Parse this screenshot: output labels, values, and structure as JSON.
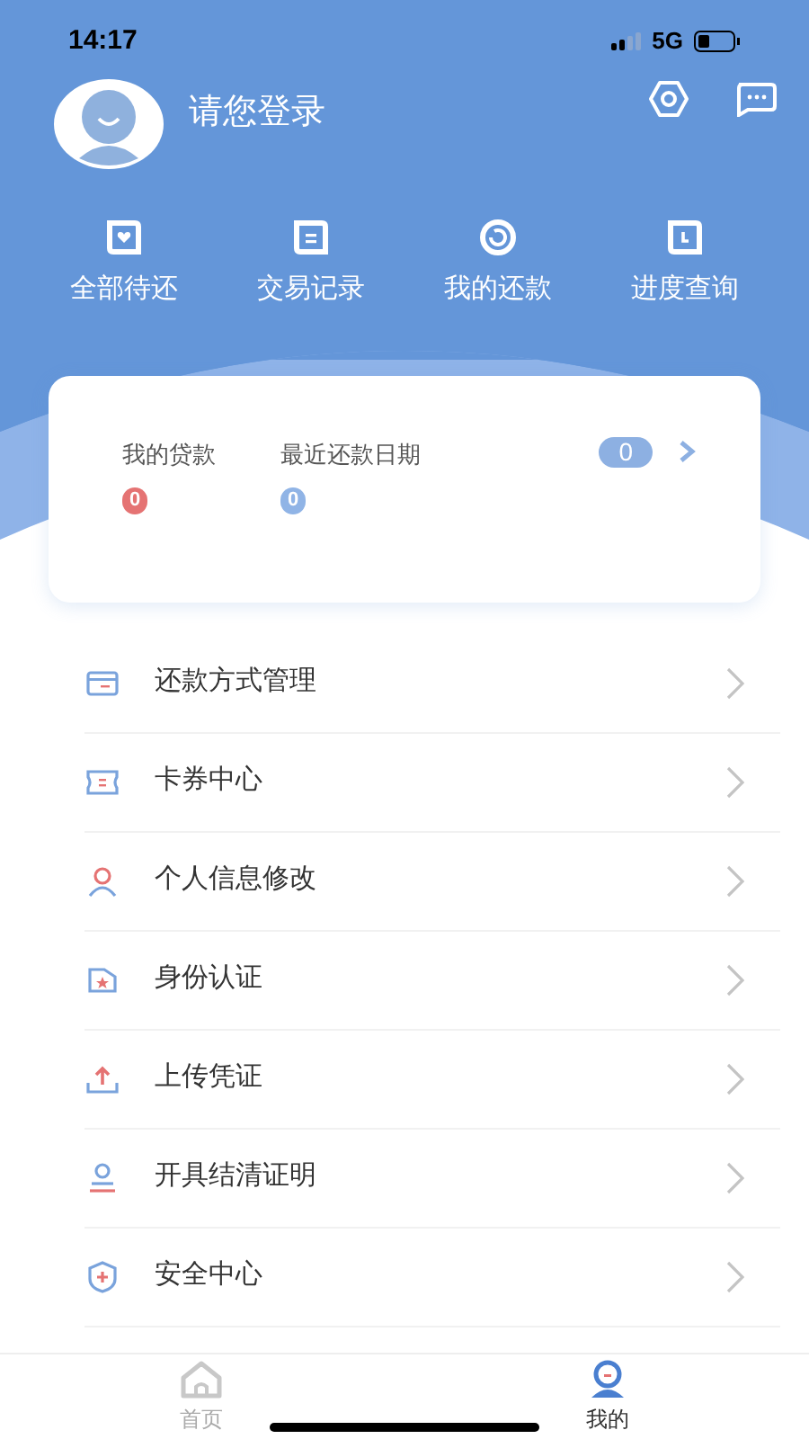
{
  "status_bar": {
    "time": "14:17",
    "network": "5G"
  },
  "profile": {
    "name": "请您登录"
  },
  "shortcuts": [
    {
      "label": "全部待还"
    },
    {
      "label": "交易记录"
    },
    {
      "label": "我的还款"
    },
    {
      "label": "进度查询"
    }
  ],
  "loan_card": {
    "stats": [
      {
        "label": "我的贷款",
        "value": "0",
        "color": "#e57373"
      },
      {
        "label": "最近还款日期",
        "value": "0",
        "color": "#90b4e6"
      }
    ],
    "count": "0"
  },
  "menu": [
    {
      "label": "还款方式管理"
    },
    {
      "label": "卡券中心"
    },
    {
      "label": "个人信息修改"
    },
    {
      "label": "身份认证"
    },
    {
      "label": "上传凭证"
    },
    {
      "label": "开具结清证明"
    },
    {
      "label": "安全中心"
    }
  ],
  "tab_bar": [
    {
      "label": "首页",
      "selected": false
    },
    {
      "label": "我的",
      "selected": true
    }
  ]
}
